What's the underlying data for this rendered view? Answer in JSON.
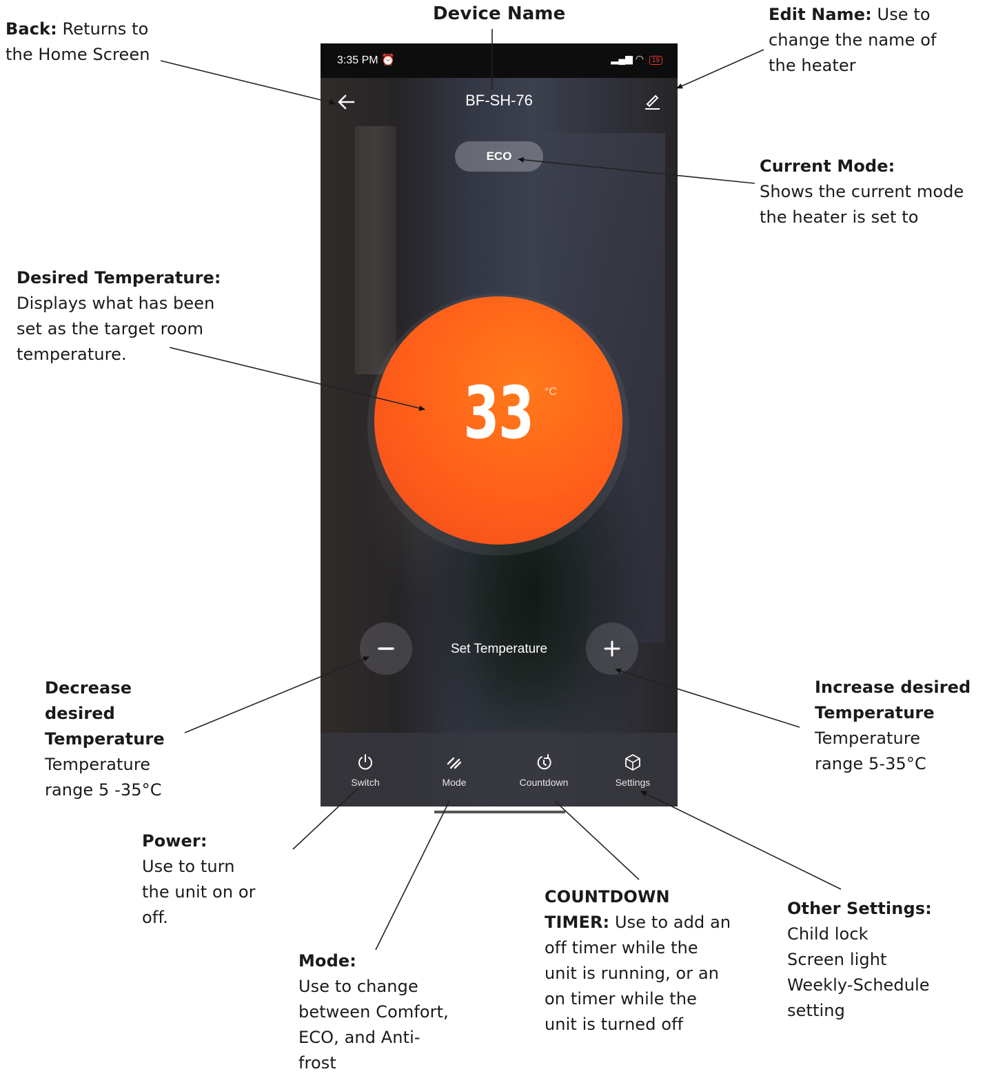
{
  "annotations": {
    "device_name": {
      "title": "Device Name"
    },
    "back": {
      "title": "Back:",
      "text": "Returns to the Home Screen"
    },
    "edit_name": {
      "title": "Edit Name:",
      "text": "Use to change the name of the heater"
    },
    "current_mode": {
      "title": "Current Mode:",
      "text": "Shows the current mode the heater is set to"
    },
    "desired_temperature": {
      "title": "Desired Temperature:",
      "text": "Displays what has been set as the target room temperature."
    },
    "decrease": {
      "title_lines": [
        "Decrease",
        "desired",
        "Temperature"
      ],
      "text_lines": [
        "Temperature",
        "range 5 -35°C"
      ]
    },
    "increase": {
      "title_lines": [
        "Increase desired",
        "Temperature"
      ],
      "text_lines": [
        "Temperature",
        "range 5-35°C"
      ]
    },
    "power": {
      "title": "Power:",
      "text_lines": [
        "Use to turn",
        "the unit on or",
        "off."
      ]
    },
    "mode": {
      "title": "Mode:",
      "text_lines": [
        "Use to change",
        "between Comfort,",
        "ECO, and Anti-",
        "frost"
      ]
    },
    "countdown": {
      "title_line1": "COUNTDOWN",
      "title_line2": "TIMER:",
      "text_first": "Use to add an",
      "text_lines": [
        "off timer while the",
        "unit is running, or an",
        "on timer while the",
        "unit is turned off"
      ]
    },
    "other_settings": {
      "title": "Other Settings:",
      "text_lines": [
        "Child lock",
        "Screen light",
        "Weekly-Schedule",
        "setting"
      ]
    }
  },
  "phone": {
    "status_bar": {
      "time": "3:35 PM",
      "alarm_icon": "alarm-icon",
      "signal_icon": "signal-icon",
      "wifi_icon": "wifi-icon",
      "battery": "19"
    },
    "nav": {
      "title": "BF-SH-76",
      "back_icon": "arrow-left-icon",
      "edit_icon": "pencil-icon"
    },
    "mode_badge": "ECO",
    "temperature": {
      "value": "33",
      "unit": "°C"
    },
    "set_temperature_label": "Set Temperature",
    "tabs": [
      {
        "label": "Switch",
        "icon": "power-icon"
      },
      {
        "label": "Mode",
        "icon": "mode-icon"
      },
      {
        "label": "Countdown",
        "icon": "countdown-icon"
      },
      {
        "label": "Settings",
        "icon": "settings-icon"
      }
    ],
    "colors": {
      "accent": "#ff5e1a",
      "status_bar": "#0d0d0d"
    }
  }
}
